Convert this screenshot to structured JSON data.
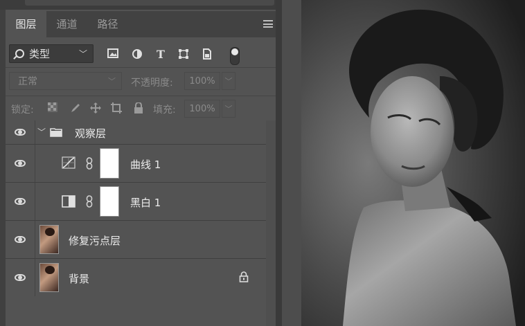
{
  "panel": {
    "tabs": [
      {
        "label": "图层",
        "active": true
      },
      {
        "label": "通道",
        "active": false
      },
      {
        "label": "路径",
        "active": false
      }
    ],
    "menu_icon": "panel-menu-icon",
    "filter": {
      "kind_label": "类型",
      "icons": [
        "image-filter-icon",
        "adjustment-filter-icon",
        "type-filter-icon",
        "shape-filter-icon",
        "smart-object-filter-icon"
      ]
    },
    "blend_mode": "正常",
    "opacity_label": "不透明度:",
    "opacity_value": "100%",
    "lock_label": "锁定:",
    "fill_label": "填充:",
    "fill_value": "100%",
    "layers": [
      {
        "name": "观察层",
        "type": "group",
        "visible": true
      },
      {
        "name": "曲线 1",
        "type": "curves-adjustment",
        "visible": true
      },
      {
        "name": "黑白 1",
        "type": "black-white-adjustment",
        "visible": true
      },
      {
        "name": "修复污点层",
        "type": "pixel",
        "visible": true
      },
      {
        "name": "背景",
        "type": "background",
        "visible": true,
        "locked": true
      }
    ]
  },
  "colors": {
    "panel_bg": "#535353",
    "tab_bar_bg": "#424242",
    "text": "#ececec",
    "muted_text": "#8a8a8a"
  }
}
